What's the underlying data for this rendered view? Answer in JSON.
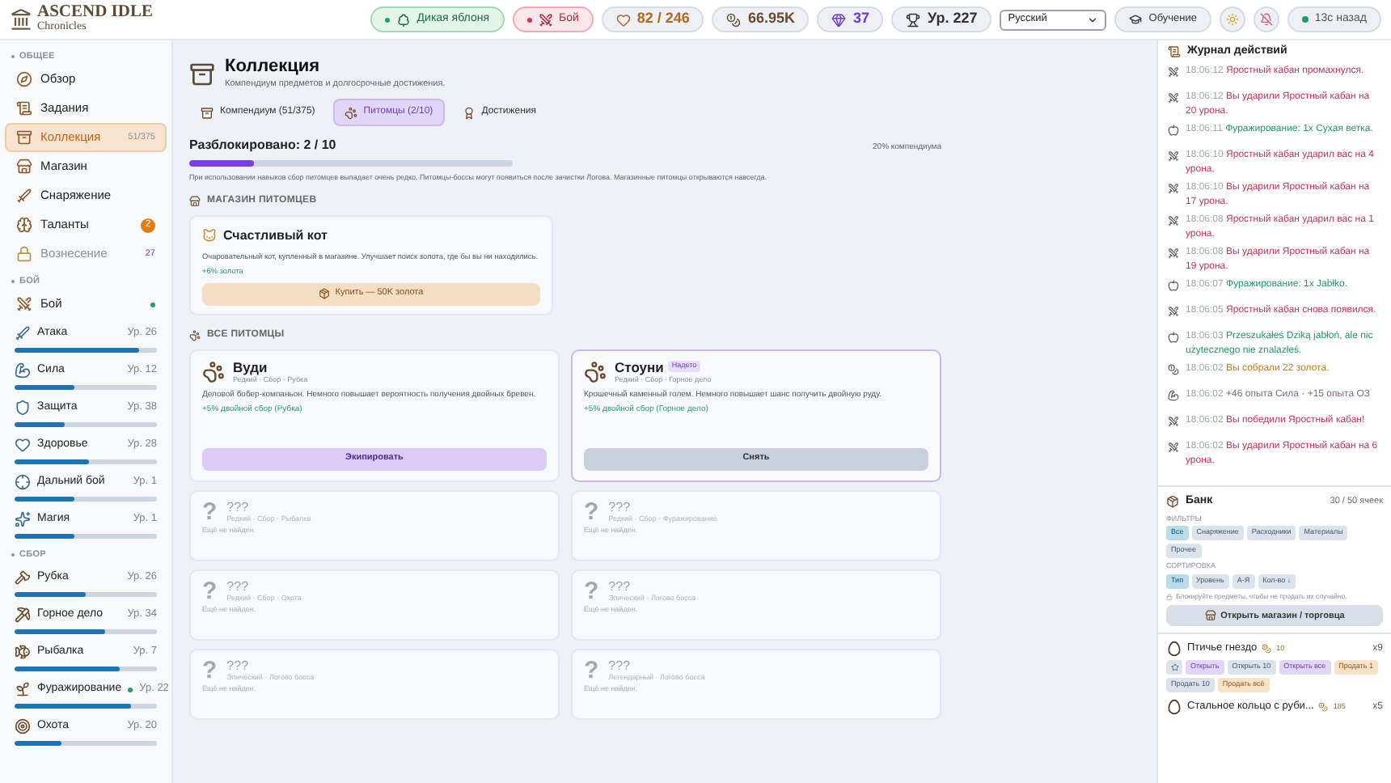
{
  "header": {
    "logo": {
      "title": "ASCEND IDLE",
      "subtitle": "Chronicles"
    },
    "chips": [
      {
        "kind": "activity",
        "text": "Дикая яблоня"
      },
      {
        "kind": "combat",
        "text": "Бой"
      },
      {
        "kind": "hp",
        "text": "82 / 246"
      },
      {
        "kind": "gold",
        "text": "66.95K"
      },
      {
        "kind": "gems",
        "text": "37"
      },
      {
        "kind": "level",
        "text": "Ур. 227"
      }
    ],
    "language": "Русский",
    "tutorial": "Обучение",
    "sync": "13с назад"
  },
  "sidebar": [
    {
      "title": "ОБЩЕЕ",
      "items": [
        {
          "kind": "nav",
          "label": "Обзор",
          "selected": false
        },
        {
          "kind": "nav",
          "label": "Задания",
          "selected": false
        },
        {
          "kind": "nav",
          "label": "Коллекция",
          "selected": true,
          "count": "51/375"
        },
        {
          "kind": "nav",
          "label": "Магазин",
          "selected": false
        },
        {
          "kind": "nav",
          "label": "Снаряжение",
          "selected": false
        },
        {
          "kind": "nav",
          "label": "Таланты",
          "selected": false,
          "badge": "2"
        },
        {
          "kind": "nav",
          "label": "Вознесение",
          "selected": false,
          "disabled": true,
          "count": "27"
        }
      ]
    },
    {
      "title": "БОЙ",
      "items": [
        {
          "kind": "nav",
          "label": "Бой",
          "selected": false,
          "active": true
        },
        {
          "kind": "skill",
          "label": "Атака",
          "level_text": "Ур. 26",
          "level": 0.88,
          "active": false
        },
        {
          "kind": "skill",
          "label": "Сила",
          "level_text": "Ур. 12",
          "level": 0.42,
          "active": false
        },
        {
          "kind": "skill",
          "label": "Защита",
          "level_text": "Ур. 38",
          "level": 0.35,
          "active": false
        },
        {
          "kind": "skill",
          "label": "Здоровье",
          "level_text": "Ур. 28",
          "level": 0.52,
          "active": false
        },
        {
          "kind": "skill",
          "label": "Дальний бой",
          "level_text": "Ур. 1",
          "level": 0.42,
          "active": false
        },
        {
          "kind": "skill",
          "label": "Магия",
          "level_text": "Ур. 1",
          "level": 0.42,
          "active": false
        }
      ]
    },
    {
      "title": "СБОР",
      "items": [
        {
          "kind": "skill",
          "label": "Рубка",
          "level_text": "Ур. 26",
          "level": 0.5,
          "active": false
        },
        {
          "kind": "skill",
          "label": "Горное дело",
          "level_text": "Ур. 34",
          "level": 0.64,
          "active": false
        },
        {
          "kind": "skill",
          "label": "Рыбалка",
          "level_text": "Ур. 7",
          "level": 0.74,
          "active": false
        },
        {
          "kind": "skill",
          "label": "Фуражирование",
          "level_text": "Ур. 22",
          "level": 0.82,
          "active": true
        },
        {
          "kind": "skill",
          "label": "Охота",
          "level_text": "Ур. 20",
          "level": 0.33,
          "active": false
        }
      ]
    }
  ],
  "page": {
    "title": "Коллекция",
    "subtitle": "Компендиум предметов и долгосрочные достижения.",
    "tabs": [
      {
        "label": "Компендиум (51/375)",
        "selected": false
      },
      {
        "label": "Питомцы (2/10)",
        "selected": true
      },
      {
        "label": "Достижения",
        "selected": false
      }
    ],
    "progress": {
      "label": "Разблокировано: 2 / 10",
      "level": 0.2,
      "share": "20% компендиума"
    },
    "note": "При использовании навыков сбор питомцев выпадает очень редко. Питомцы-боссы могут появиться после зачистки Логова. Магазинные питомцы открываются навсегда.",
    "shop": {
      "title": "МАГАЗИН ПИТОМЦЕВ",
      "pet": {
        "name": "Счастливый кот",
        "description": "Очаровательный кот, купленный в магазине. Улучшает поиск золота, где бы вы ни находились.",
        "bonus": "+6% золота",
        "button": "Купить — 50K золота"
      }
    },
    "all_title": "ВСЕ ПИТОМЦЫ",
    "pets": [
      {
        "kind": "found",
        "name": "Вуди",
        "meta": "Редкий · Сбор · Рубка",
        "description": "Деловой бобер-компаньон. Немного повышает вероятность получения двойных бревен.",
        "bonus": "+5% двойной сбор (Рубка)",
        "equipped": false,
        "button": "Экипировать"
      },
      {
        "kind": "found",
        "name": "Стоуни",
        "badge": "Надето",
        "meta": "Редкий · Сбор · Горное дело",
        "description": "Крошечный каменный голем. Немного повышает шанс получить двойную руду.",
        "bonus": "+5% двойной сбор (Горное дело)",
        "equipped": true,
        "button": "Снять"
      },
      {
        "kind": "unknown",
        "symbol": "?",
        "name": "???",
        "meta": "Редкий · Сбор · Рыбалка",
        "description": "Ещё не найден."
      },
      {
        "kind": "unknown",
        "symbol": "?",
        "name": "???",
        "meta": "Редкий · Сбор · Фуражирование",
        "description": "Ещё не найден."
      },
      {
        "kind": "unknown",
        "symbol": "?",
        "name": "???",
        "meta": "Редкий · Сбор · Охота",
        "description": "Ещё не найден."
      },
      {
        "kind": "unknown",
        "symbol": "?",
        "name": "???",
        "meta": "Эпический · Логово босса",
        "description": "Ещё не найден."
      },
      {
        "kind": "unknown",
        "symbol": "?",
        "name": "???",
        "meta": "Эпический · Логово босса",
        "description": "Ещё не найден."
      },
      {
        "kind": "unknown",
        "symbol": "?",
        "name": "???",
        "meta": "Легендарный · Логово босса",
        "description": "Ещё не найден."
      }
    ]
  },
  "log": {
    "title": "Журнал действий",
    "entries": [
      {
        "kind": "combat",
        "time": "18:06:12",
        "text": "Яростный кабан промахнулся."
      },
      {
        "kind": "combat",
        "time": "18:06:12",
        "text": "Вы ударили Яростный кабан на 20 урона."
      },
      {
        "kind": "gather",
        "time": "18:06:11",
        "text": "Фуражирование: 1x Сухая ветка."
      },
      {
        "kind": "combat",
        "time": "18:06:10",
        "text": "Яростный кабан ударил вас на 4 урона."
      },
      {
        "kind": "combat",
        "time": "18:06:10",
        "text": "Вы ударили Яростный кабан на 17 урона."
      },
      {
        "kind": "combat",
        "time": "18:06:08",
        "text": "Яростный кабан ударил вас на 1 урона."
      },
      {
        "kind": "combat",
        "time": "18:06:08",
        "text": "Вы ударили Яростный кабан на 19 урона."
      },
      {
        "kind": "gather",
        "time": "18:06:07",
        "text": "Фуражирование: 1x Jabłko."
      },
      {
        "kind": "combat",
        "time": "18:06:05",
        "text": "Яростный кабан снова появился."
      },
      {
        "kind": "gather",
        "time": "18:06:03",
        "text": "Przeszukałeś Dziką jabłoń, ale nic użytecznego nie znalazłeś."
      },
      {
        "kind": "gold",
        "time": "18:06:02",
        "text": "Вы собрали 22 золота."
      },
      {
        "kind": "xp",
        "time": "18:06:02",
        "text": "+46 опыта Сила · +15 опыта ОЗ"
      },
      {
        "kind": "combat",
        "time": "18:06:02",
        "text": "Вы победили Яростный кабан!"
      },
      {
        "kind": "combat",
        "time": "18:06:02",
        "text": "Вы ударили Яростный кабан на 6 урона."
      }
    ]
  },
  "bank": {
    "title": "Банк",
    "capacity": "30 / 50 ячеек",
    "filters_label": "ФИЛЬТРЫ",
    "filters": [
      {
        "label": "Все",
        "selected": true
      },
      {
        "label": "Снаряжение",
        "selected": false
      },
      {
        "label": "Расходники",
        "selected": false
      },
      {
        "label": "Материалы",
        "selected": false
      },
      {
        "label": "Прочее",
        "selected": false
      }
    ],
    "sort_label": "СОРТИРОВКА",
    "sorts": [
      {
        "label": "Тип",
        "selected": true
      },
      {
        "label": "Уровень",
        "selected": false
      },
      {
        "label": "А-Я",
        "selected": false
      },
      {
        "label": "Кол-во ↓",
        "selected": false
      }
    ],
    "hint": "Блокируйте предметы, чтобы не продать их случайно.",
    "button": "Открыть магазин / торговца",
    "items": [
      {
        "name": "Птичье гнездо",
        "price": "10",
        "qty": "x9",
        "actions": [
          {
            "kind": "favorite"
          },
          {
            "kind": "open",
            "label": "Открыть"
          },
          {
            "kind": "secondary",
            "label": "Открыть 10"
          },
          {
            "kind": "open",
            "label": "Открыть все"
          },
          {
            "kind": "sell",
            "label": "Продать 1"
          },
          {
            "kind": "secondary",
            "label": "Продать 10"
          },
          {
            "kind": "sell",
            "label": "Продать всё"
          }
        ]
      },
      {
        "name": "Стальное кольцо с руби...",
        "price": "185",
        "qty": "x5"
      }
    ]
  }
}
